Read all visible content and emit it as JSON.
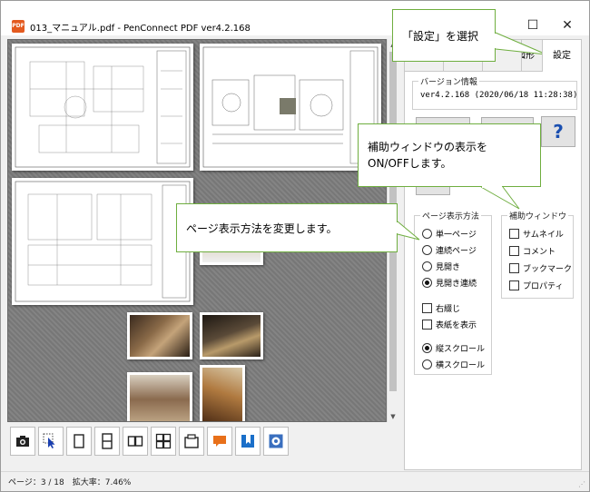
{
  "window": {
    "title": "013_マニュアル.pdf - PenConnect PDF ver4.2.168",
    "app_icon_label": "PDF",
    "controls": {
      "maximize": "☐",
      "close": "✕"
    }
  },
  "tabs": {
    "partial": "図形",
    "settings": "設定"
  },
  "version_group": {
    "title": "バージョン情報",
    "text": "ver4.2.168 (2020/06/18 11:28:38)"
  },
  "help_button": "?",
  "display_group": {
    "title": "ページ表示方法",
    "options": [
      {
        "label": "単一ページ",
        "selected": false
      },
      {
        "label": "連続ページ",
        "selected": false
      },
      {
        "label": "見開き",
        "selected": false
      },
      {
        "label": "見開き連続",
        "selected": true
      }
    ],
    "checks": [
      {
        "label": "右綴じ",
        "checked": false
      },
      {
        "label": "表紙を表示",
        "checked": false
      }
    ],
    "scroll": [
      {
        "label": "縦スクロール",
        "selected": true
      },
      {
        "label": "横スクロール",
        "selected": false
      }
    ]
  },
  "aux_group": {
    "title": "補助ウィンドウ",
    "checks": [
      {
        "label": "サムネイル",
        "checked": false
      },
      {
        "label": "コメント",
        "checked": false
      },
      {
        "label": "ブックマーク",
        "checked": false
      },
      {
        "label": "プロパティ",
        "checked": false
      }
    ]
  },
  "callouts": {
    "settings": "「設定」を選択",
    "aux_line1": "補助ウィンドウの表示を",
    "aux_line2": "ON/OFFします。",
    "display": "ページ表示方法を変更します。"
  },
  "status": {
    "text": "ページ：3 / 18　拡大率：7.46%"
  },
  "toolbar": [
    {
      "name": "camera-icon"
    },
    {
      "name": "select-pointer-icon"
    },
    {
      "name": "single-page-icon"
    },
    {
      "name": "continuous-page-icon"
    },
    {
      "name": "two-page-icon"
    },
    {
      "name": "two-page-continuous-icon"
    },
    {
      "name": "fit-page-icon"
    },
    {
      "name": "comment-icon"
    },
    {
      "name": "bookmark-icon"
    },
    {
      "name": "properties-icon"
    }
  ],
  "colors": {
    "callout_border": "#6fae3f",
    "help_icon": "#1a4fb0",
    "comment_icon": "#e8701a",
    "bookmark_icon": "#1a6fc9"
  }
}
